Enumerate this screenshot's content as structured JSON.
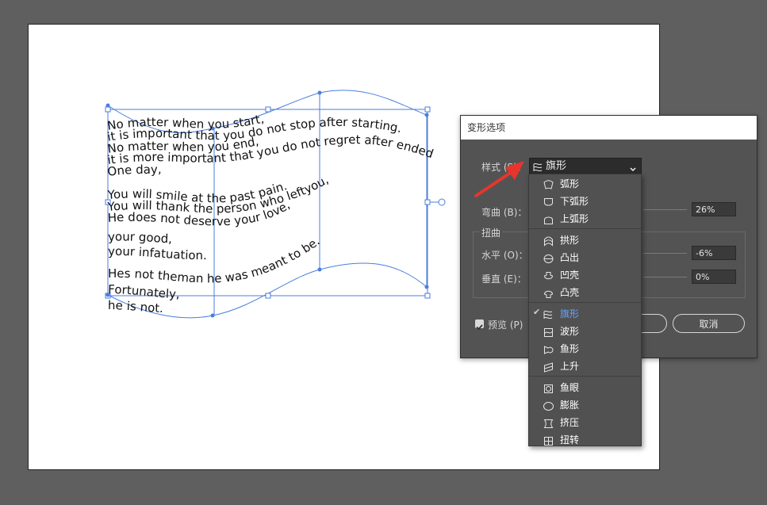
{
  "artboard_text": [
    "No matter when you start,",
    "it is important that you do not stop after starting.",
    "No matter when you end,",
    "it is more important that you do not regret after ended.",
    "One day,",
    "You will smile at the past pain.",
    "You will thank the person who leftyou,",
    "He does not deserve your love,",
    "your good,",
    "your infatuation.",
    "Hes not theman he was meant to be.",
    "Fortunately,",
    "he is not."
  ],
  "dialog": {
    "title": "变形选项",
    "style_label": "样式 (S)：",
    "style_value": "旗形",
    "bend_label": "弯曲 (B)：",
    "bend_value": "26%",
    "distortion_group": "扭曲",
    "horizontal_label": "水平 (O)：",
    "horizontal_value": "-6%",
    "vertical_label": "垂直 (E)：",
    "vertical_value": "0%",
    "preview_label": "预览 (P)",
    "preview_checked": true,
    "ok_label": "",
    "cancel_label": "取消"
  },
  "style_menu": {
    "selected": "旗形",
    "groups": [
      [
        {
          "label": "弧形",
          "icon": "arc-icon"
        },
        {
          "label": "下弧形",
          "icon": "arc-lower-icon"
        },
        {
          "label": "上弧形",
          "icon": "arc-upper-icon"
        }
      ],
      [
        {
          "label": "拱形",
          "icon": "arch-icon"
        },
        {
          "label": "凸出",
          "icon": "bulge-icon"
        },
        {
          "label": "凹壳",
          "icon": "shell-lower-icon"
        },
        {
          "label": "凸壳",
          "icon": "shell-upper-icon"
        }
      ],
      [
        {
          "label": "旗形",
          "icon": "flag-icon"
        },
        {
          "label": "波形",
          "icon": "wave-icon"
        },
        {
          "label": "鱼形",
          "icon": "fish-icon"
        },
        {
          "label": "上升",
          "icon": "rise-icon"
        }
      ],
      [
        {
          "label": "鱼眼",
          "icon": "fisheye-icon"
        },
        {
          "label": "膨胀",
          "icon": "inflate-icon"
        },
        {
          "label": "挤压",
          "icon": "squeeze-icon"
        },
        {
          "label": "扭转",
          "icon": "twist-icon"
        }
      ]
    ]
  },
  "colors": {
    "canvas": "#5f5f5f",
    "artboard": "#ffffff",
    "selection": "#4a7ee0",
    "dialog": "#535353",
    "menu": "#515151",
    "arrow": "#e8352b"
  }
}
